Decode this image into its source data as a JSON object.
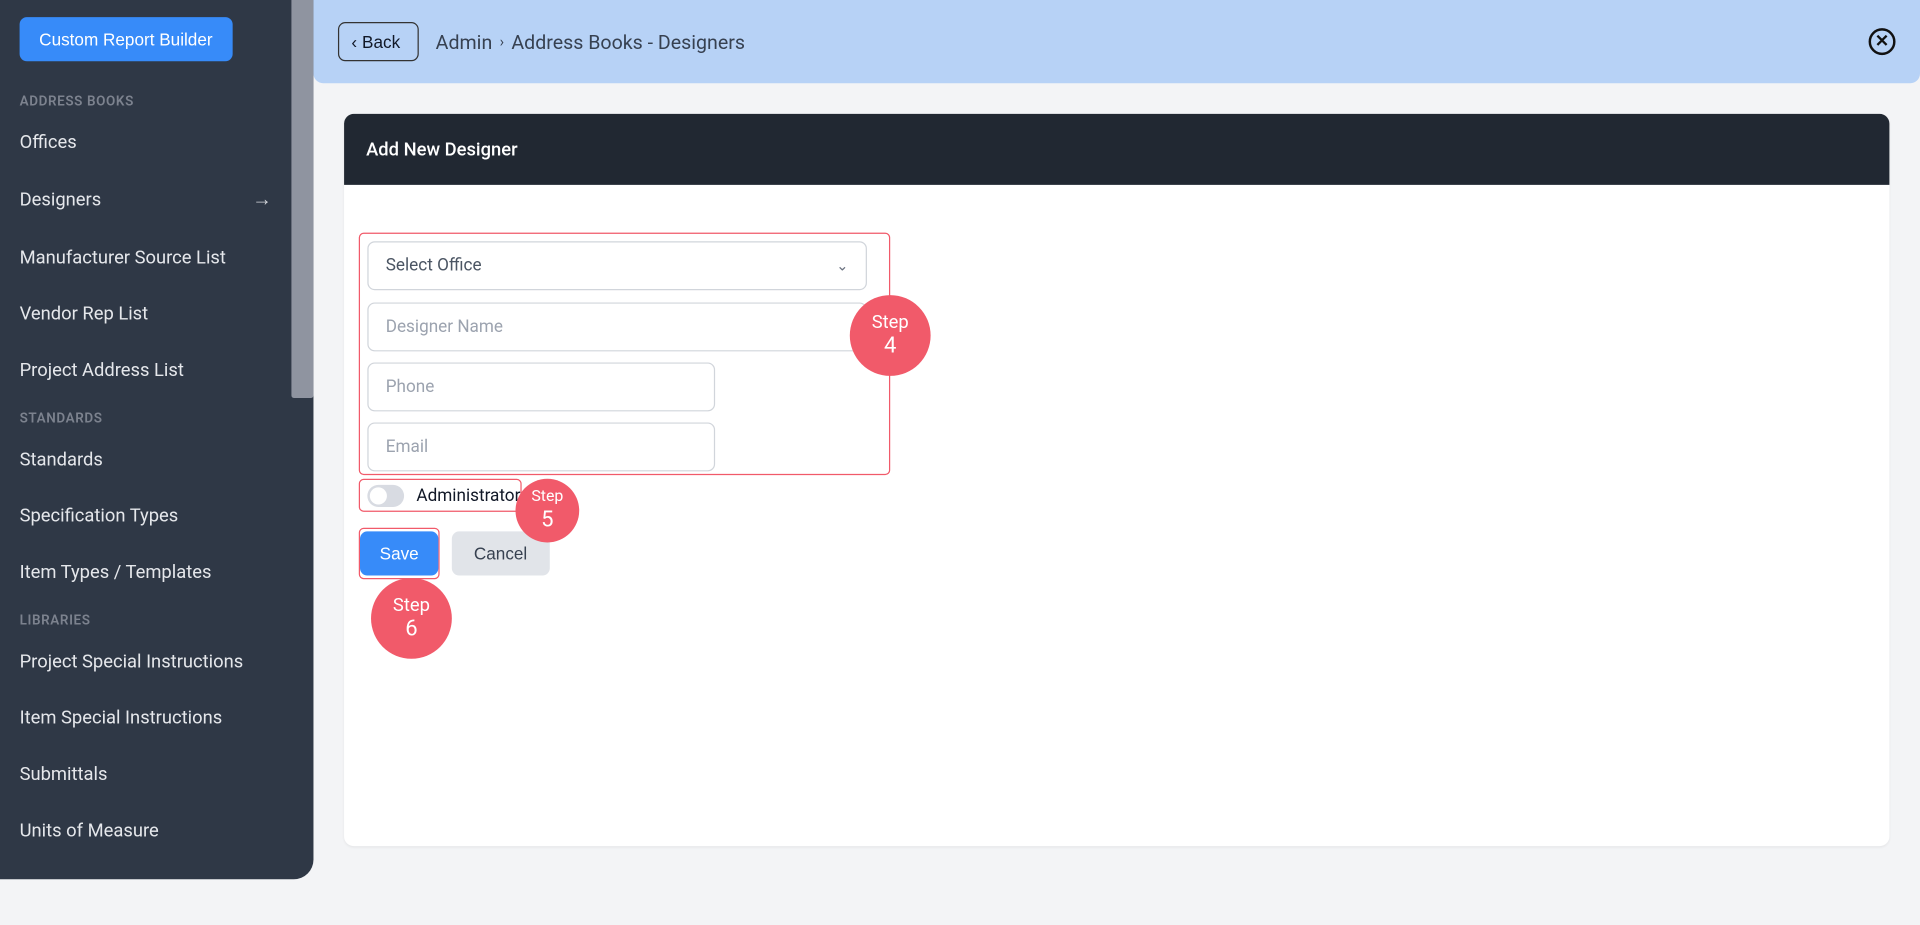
{
  "sidebar": {
    "custom_report_builder": "Custom Report Builder",
    "sections": {
      "address_books": "ADDRESS BOOKS",
      "standards": "STANDARDS",
      "libraries": "LIBRARIES"
    },
    "items": {
      "offices": "Offices",
      "designers": "Designers",
      "manufacturer_source_list": "Manufacturer Source List",
      "vendor_rep_list": "Vendor Rep List",
      "project_address_list": "Project Address List",
      "standards": "Standards",
      "specification_types": "Specification Types",
      "item_types_templates": "Item Types / Templates",
      "project_special_instructions": "Project Special Instructions",
      "item_special_instructions": "Item Special Instructions",
      "submittals": "Submittals",
      "units_of_measure": "Units of Measure"
    }
  },
  "header": {
    "back_label": "Back",
    "breadcrumb_root": "Admin",
    "breadcrumb_current": "Address Books - Designers"
  },
  "card": {
    "title": "Add New Designer"
  },
  "form": {
    "select_office_placeholder": "Select Office",
    "designer_name_placeholder": "Designer Name",
    "phone_placeholder": "Phone",
    "email_placeholder": "Email",
    "admin_label": "Administrator",
    "save_label": "Save",
    "cancel_label": "Cancel"
  },
  "annotations": {
    "step4_a": "Step",
    "step4_b": "4",
    "step5_a": "Step",
    "step5_b": "5",
    "step6_a": "Step",
    "step6_b": "6"
  }
}
